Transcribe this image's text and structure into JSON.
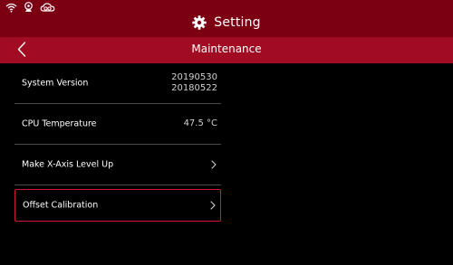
{
  "status_bar": {
    "icons": [
      "wifi-icon",
      "webcam-icon",
      "cloud-link-icon"
    ]
  },
  "header": {
    "title": "Setting",
    "icon": "gear-icon"
  },
  "subheader": {
    "title": "Maintenance",
    "back_icon": "chevron-left-icon"
  },
  "rows": [
    {
      "label": "System Version",
      "value_line1": "20190530",
      "value_line2": "20180522"
    },
    {
      "label": "CPU Temperature",
      "value": "47.5 °C"
    },
    {
      "label": "Make X-Axis Level Up",
      "chevron": "chevron-right-icon"
    },
    {
      "label": "Offset Calibration",
      "chevron": "chevron-right-icon",
      "selected": true
    }
  ],
  "colors": {
    "top_bar": "#7a0012",
    "sub_bar": "#a10c22",
    "selection_border": "#d1162f",
    "background": "#000000"
  }
}
